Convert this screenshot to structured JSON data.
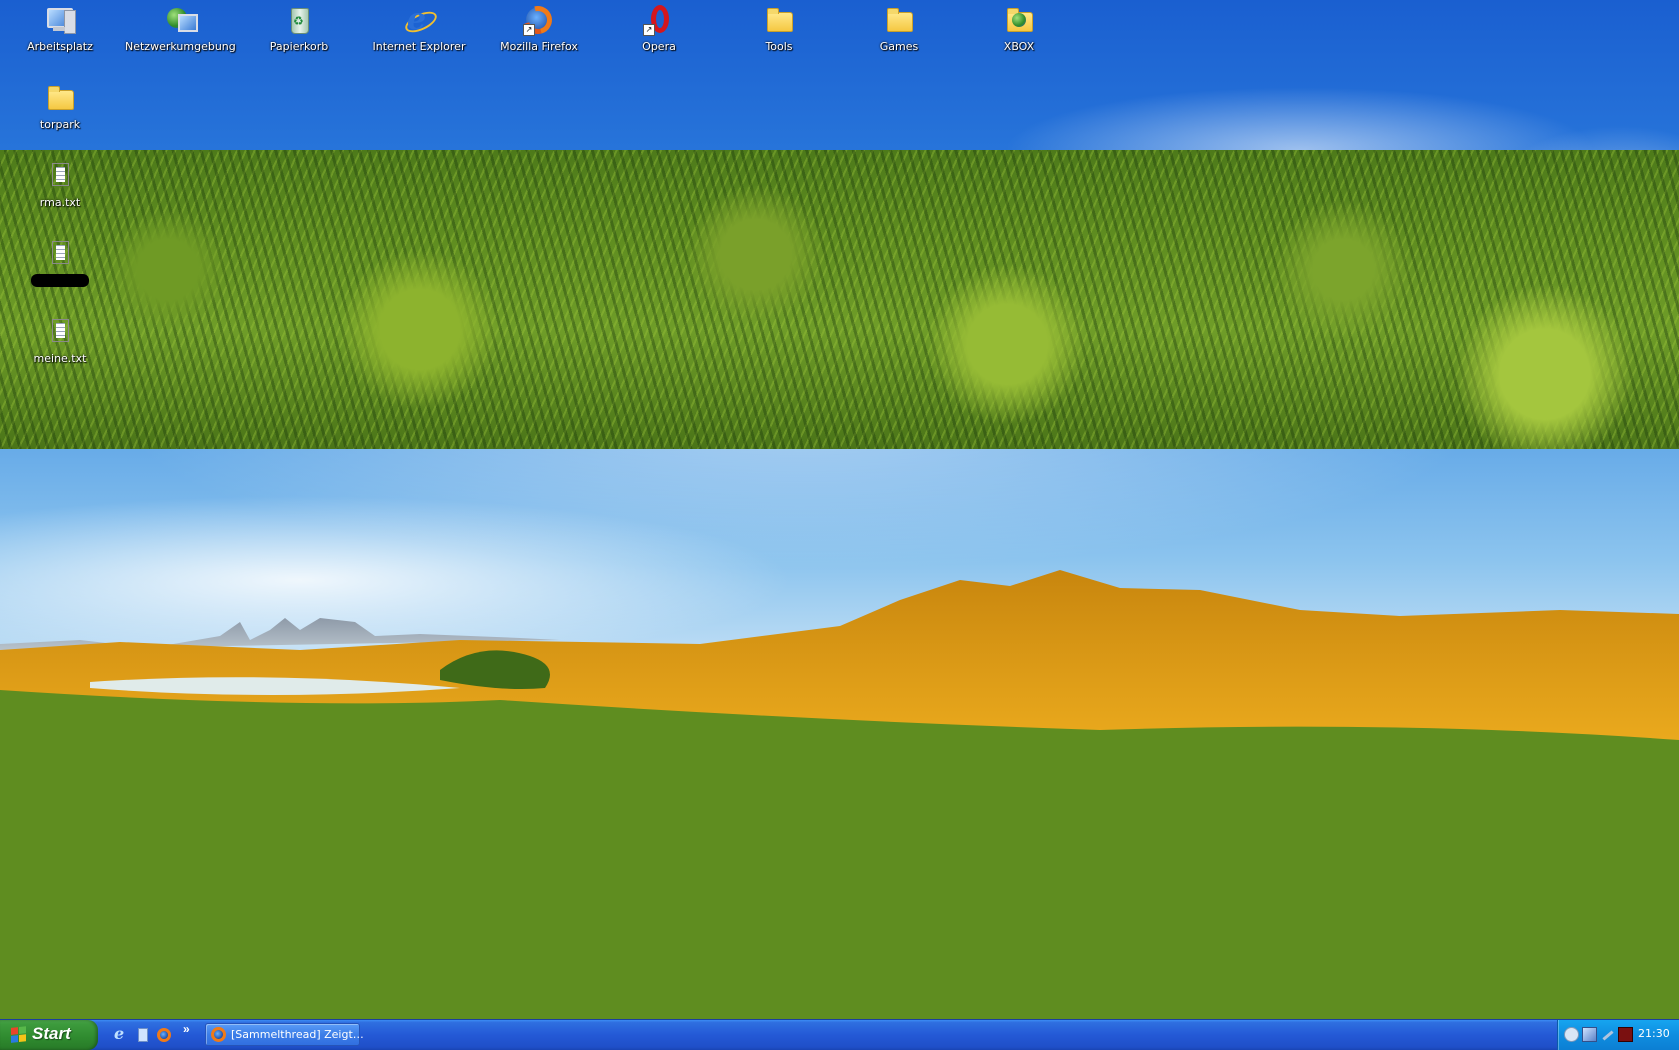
{
  "desktop": {
    "icons": [
      {
        "label": "Arbeitsplatz",
        "icon": "my-computer-icon"
      },
      {
        "label": "Netzwerkumgebung",
        "icon": "network-places-icon"
      },
      {
        "label": "Papierkorb",
        "icon": "recycle-bin-icon"
      },
      {
        "label": "Internet Explorer",
        "icon": "internet-explorer-icon"
      },
      {
        "label": "Mozilla Firefox",
        "icon": "firefox-icon"
      },
      {
        "label": "Opera",
        "icon": "opera-icon"
      },
      {
        "label": "Tools",
        "icon": "folder-icon"
      },
      {
        "label": "Games",
        "icon": "folder-icon"
      },
      {
        "label": "XBOX",
        "icon": "network-folder-icon"
      },
      {
        "label": "torpark",
        "icon": "folder-icon"
      },
      {
        "label": "rma.txt",
        "icon": "text-file-icon"
      },
      {
        "label": "",
        "icon": "text-file-icon"
      },
      {
        "label": "meine.txt",
        "icon": "text-file-icon"
      }
    ]
  },
  "taskbar": {
    "start_label": "Start",
    "quick_launch": [
      "internet-explorer-icon",
      "show-desktop-icon",
      "firefox-icon"
    ],
    "overflow_label": "»",
    "tasks": [
      {
        "label": "[Sammelthread] Zeigt…",
        "icon": "firefox-icon"
      }
    ],
    "clock": "21:30",
    "colors": {
      "taskbar": "#2459d6",
      "start": "#2f8a2f",
      "tray": "#0f8de0"
    }
  }
}
